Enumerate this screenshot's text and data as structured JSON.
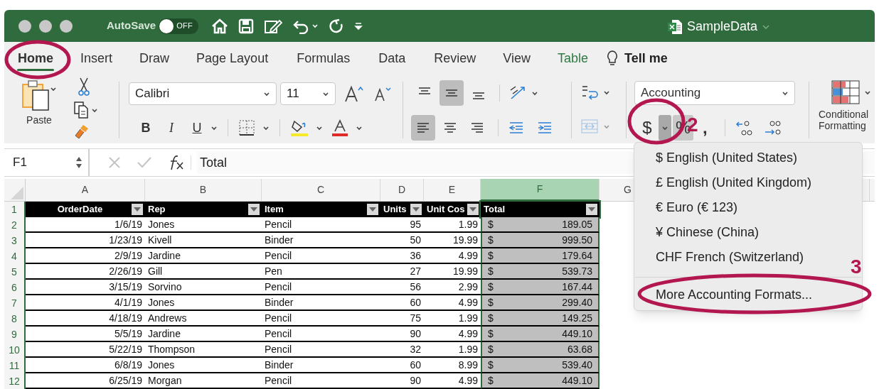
{
  "title_bar": {
    "autosave_label": "AutoSave",
    "autosave_toggle": {
      "on": false,
      "label": "OFF"
    },
    "document_title": "SampleData"
  },
  "tabs": [
    {
      "label": "Home",
      "selected": true,
      "contextual": false
    },
    {
      "label": "Insert",
      "selected": false,
      "contextual": false
    },
    {
      "label": "Draw",
      "selected": false,
      "contextual": false
    },
    {
      "label": "Page Layout",
      "selected": false,
      "contextual": false
    },
    {
      "label": "Formulas",
      "selected": false,
      "contextual": false
    },
    {
      "label": "Data",
      "selected": false,
      "contextual": false
    },
    {
      "label": "Review",
      "selected": false,
      "contextual": false
    },
    {
      "label": "View",
      "selected": false,
      "contextual": false
    },
    {
      "label": "Table",
      "selected": false,
      "contextual": true
    }
  ],
  "tell_me": "Tell me",
  "ribbon": {
    "paste_label": "Paste",
    "font_name": "Calibri",
    "font_size": "11",
    "style_buttons": [
      {
        "label": "B",
        "kind": "bold"
      },
      {
        "label": "I",
        "kind": "italic"
      },
      {
        "label": "U",
        "kind": "underline"
      }
    ],
    "vertical_align": [
      {
        "selected": false
      },
      {
        "selected": true
      },
      {
        "selected": false
      }
    ],
    "horizontal_align": [
      {
        "selected": true
      },
      {
        "selected": false
      },
      {
        "selected": false
      }
    ],
    "merge_disabled": true,
    "number_format": "Accounting",
    "number_buttons": [
      {
        "label": "$",
        "kind": "currency",
        "pressed": false,
        "caret_pressed": true
      },
      {
        "label": "%",
        "kind": "percent",
        "pressed": true
      },
      {
        "label": ",",
        "kind": "comma",
        "pressed": false
      }
    ],
    "conditional_formatting": "Conditional Formatting"
  },
  "formula_bar": {
    "name_box": "F1",
    "formula": "Total"
  },
  "sheet": {
    "columns": [
      {
        "label": "A",
        "selected": false
      },
      {
        "label": "B",
        "selected": false
      },
      {
        "label": "C",
        "selected": false
      },
      {
        "label": "D",
        "selected": false
      },
      {
        "label": "E",
        "selected": false
      },
      {
        "label": "F",
        "selected": true
      },
      {
        "label": "G",
        "selected": false
      }
    ],
    "header": {
      "row": "1",
      "cells": [
        "OrderDate",
        "Rep",
        "Item",
        "Units",
        "Unit Cos",
        "Total"
      ]
    },
    "rows": [
      {
        "row": "2",
        "cells": [
          "1/6/19",
          "Jones",
          "Pencil",
          "95",
          "1.99",
          "$",
          "189.05"
        ]
      },
      {
        "row": "3",
        "cells": [
          "1/23/19",
          "Kivell",
          "Binder",
          "50",
          "19.99",
          "$",
          "999.50"
        ]
      },
      {
        "row": "4",
        "cells": [
          "2/9/19",
          "Jardine",
          "Pencil",
          "36",
          "4.99",
          "$",
          "179.64"
        ]
      },
      {
        "row": "5",
        "cells": [
          "2/26/19",
          "Gill",
          "Pen",
          "27",
          "19.99",
          "$",
          "539.73"
        ]
      },
      {
        "row": "6",
        "cells": [
          "3/15/19",
          "Sorvino",
          "Pencil",
          "56",
          "2.99",
          "$",
          "167.44"
        ]
      },
      {
        "row": "7",
        "cells": [
          "4/1/19",
          "Jones",
          "Binder",
          "60",
          "4.99",
          "$",
          "299.40"
        ]
      },
      {
        "row": "8",
        "cells": [
          "4/18/19",
          "Andrews",
          "Pencil",
          "75",
          "1.99",
          "$",
          "149.25"
        ]
      },
      {
        "row": "9",
        "cells": [
          "5/5/19",
          "Jardine",
          "Pencil",
          "90",
          "4.99",
          "$",
          "449.10"
        ]
      },
      {
        "row": "10",
        "cells": [
          "5/22/19",
          "Thompson",
          "Pencil",
          "32",
          "1.99",
          "$",
          "63.68"
        ]
      },
      {
        "row": "11",
        "cells": [
          "6/8/19",
          "Jones",
          "Binder",
          "60",
          "8.99",
          "$",
          "539.40"
        ]
      },
      {
        "row": "12",
        "cells": [
          "6/25/19",
          "Morgan",
          "Pencil",
          "90",
          "4.99",
          "$",
          "449.10"
        ]
      }
    ]
  },
  "currency_menu": {
    "items": [
      "$ English (United States)",
      "£ English (United Kingdom)",
      "€ Euro (€ 123)",
      "¥ Chinese (China)",
      "CHF French (Switzerland)"
    ],
    "more": "More Accounting Formats..."
  },
  "annotations": [
    {
      "label": "2"
    },
    {
      "label": "3"
    }
  ]
}
